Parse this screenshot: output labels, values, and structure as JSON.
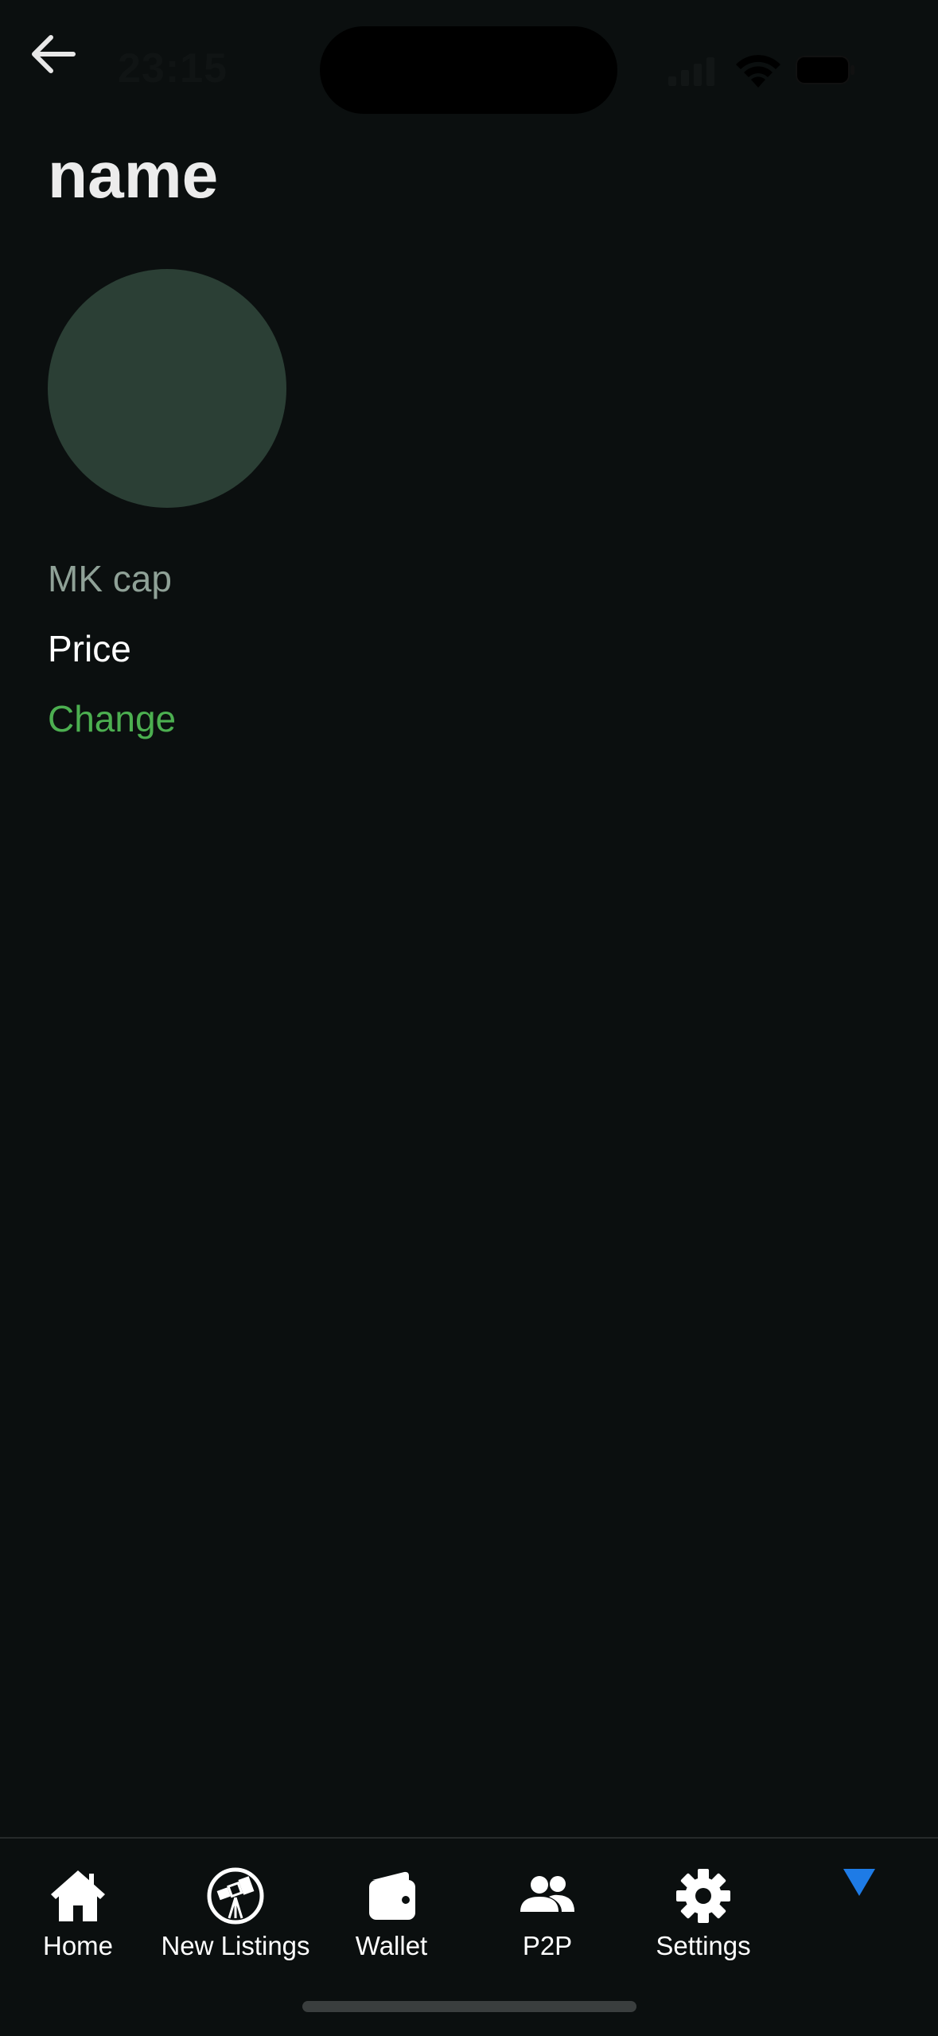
{
  "status_bar": {
    "time": "23:15"
  },
  "header": {
    "title": "name"
  },
  "token": {
    "mk_cap_label": "MK cap",
    "price_label": "Price",
    "change_label": "Change"
  },
  "colors": {
    "background": "#0b0f0f",
    "avatar": "#2b3f35",
    "mk_cap_text": "#8fa197",
    "change_text": "#4caf50",
    "dropdown_accent": "#1e7be6"
  },
  "tab_bar": {
    "items": [
      {
        "label": "Home",
        "icon": "home-icon"
      },
      {
        "label": "New Listings",
        "icon": "telescope-icon"
      },
      {
        "label": "Wallet",
        "icon": "wallet-icon"
      },
      {
        "label": "P2P",
        "icon": "users-icon"
      },
      {
        "label": "Settings",
        "icon": "gear-icon"
      }
    ],
    "extra_icon": "triangle-down-icon"
  }
}
